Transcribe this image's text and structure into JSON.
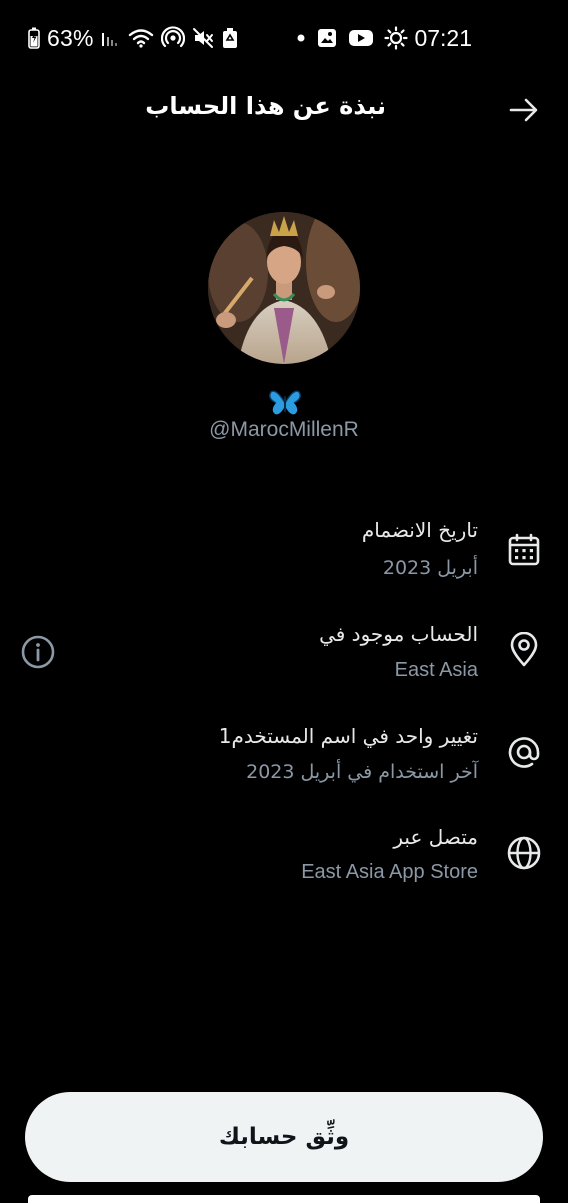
{
  "status_bar": {
    "battery_percent": "63%",
    "time": "07:21",
    "icons": [
      "battery-icon",
      "signal-icon",
      "wifi-icon",
      "hotspot-icon",
      "mute-icon",
      "recycle-icon",
      "dot-icon",
      "gallery-icon",
      "youtube-icon",
      "brightness-icon"
    ]
  },
  "header": {
    "title": "نبذة عن هذا الحساب",
    "back_icon": "arrow-right-icon"
  },
  "profile": {
    "emoji": "🦋",
    "handle": "@MarocMillenR"
  },
  "rows": [
    {
      "icon": "calendar-icon",
      "title": "تاريخ الانضمام",
      "subtitle": "أبريل 2023"
    },
    {
      "icon": "location-pin-icon",
      "title": "الحساب موجود في",
      "subtitle": "East Asia",
      "info_icon": "info-icon"
    },
    {
      "icon": "at-sign-icon",
      "title": "تغيير واحد في اسم المستخدم1",
      "subtitle": "آخر استخدام في أبريل 2023"
    },
    {
      "icon": "globe-icon",
      "title": "متصل عبر",
      "subtitle": "East Asia App Store"
    }
  ],
  "verify_button": {
    "label": "وثِّق حسابك"
  },
  "colors": {
    "background": "#000000",
    "primary_text": "#e7e9ea",
    "secondary_text": "#8b98a5",
    "button_bg": "#eff3f4",
    "button_text": "#0f1419"
  }
}
